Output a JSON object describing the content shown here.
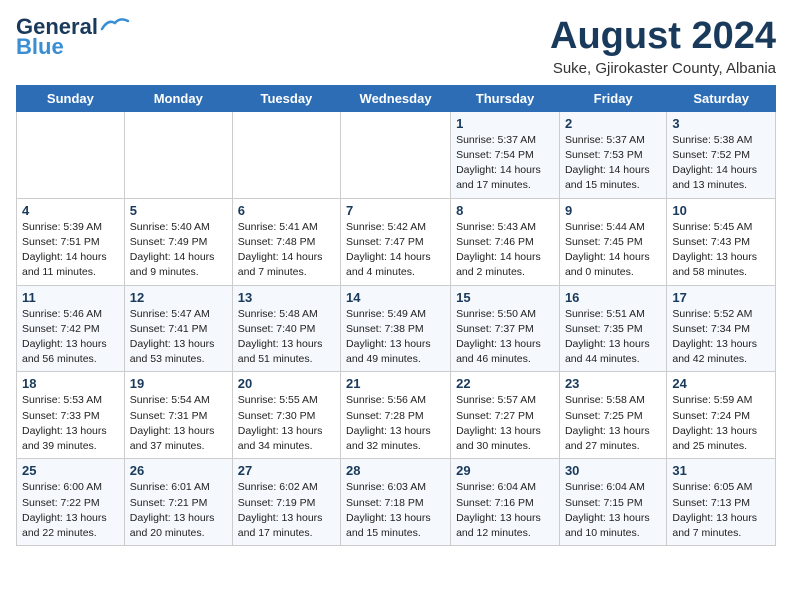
{
  "header": {
    "logo_line1": "General",
    "logo_line2": "Blue",
    "month": "August 2024",
    "location": "Suke, Gjirokaster County, Albania"
  },
  "weekdays": [
    "Sunday",
    "Monday",
    "Tuesday",
    "Wednesday",
    "Thursday",
    "Friday",
    "Saturday"
  ],
  "weeks": [
    [
      {
        "day": "",
        "info": ""
      },
      {
        "day": "",
        "info": ""
      },
      {
        "day": "",
        "info": ""
      },
      {
        "day": "",
        "info": ""
      },
      {
        "day": "1",
        "info": "Sunrise: 5:37 AM\nSunset: 7:54 PM\nDaylight: 14 hours\nand 17 minutes."
      },
      {
        "day": "2",
        "info": "Sunrise: 5:37 AM\nSunset: 7:53 PM\nDaylight: 14 hours\nand 15 minutes."
      },
      {
        "day": "3",
        "info": "Sunrise: 5:38 AM\nSunset: 7:52 PM\nDaylight: 14 hours\nand 13 minutes."
      }
    ],
    [
      {
        "day": "4",
        "info": "Sunrise: 5:39 AM\nSunset: 7:51 PM\nDaylight: 14 hours\nand 11 minutes."
      },
      {
        "day": "5",
        "info": "Sunrise: 5:40 AM\nSunset: 7:49 PM\nDaylight: 14 hours\nand 9 minutes."
      },
      {
        "day": "6",
        "info": "Sunrise: 5:41 AM\nSunset: 7:48 PM\nDaylight: 14 hours\nand 7 minutes."
      },
      {
        "day": "7",
        "info": "Sunrise: 5:42 AM\nSunset: 7:47 PM\nDaylight: 14 hours\nand 4 minutes."
      },
      {
        "day": "8",
        "info": "Sunrise: 5:43 AM\nSunset: 7:46 PM\nDaylight: 14 hours\nand 2 minutes."
      },
      {
        "day": "9",
        "info": "Sunrise: 5:44 AM\nSunset: 7:45 PM\nDaylight: 14 hours\nand 0 minutes."
      },
      {
        "day": "10",
        "info": "Sunrise: 5:45 AM\nSunset: 7:43 PM\nDaylight: 13 hours\nand 58 minutes."
      }
    ],
    [
      {
        "day": "11",
        "info": "Sunrise: 5:46 AM\nSunset: 7:42 PM\nDaylight: 13 hours\nand 56 minutes."
      },
      {
        "day": "12",
        "info": "Sunrise: 5:47 AM\nSunset: 7:41 PM\nDaylight: 13 hours\nand 53 minutes."
      },
      {
        "day": "13",
        "info": "Sunrise: 5:48 AM\nSunset: 7:40 PM\nDaylight: 13 hours\nand 51 minutes."
      },
      {
        "day": "14",
        "info": "Sunrise: 5:49 AM\nSunset: 7:38 PM\nDaylight: 13 hours\nand 49 minutes."
      },
      {
        "day": "15",
        "info": "Sunrise: 5:50 AM\nSunset: 7:37 PM\nDaylight: 13 hours\nand 46 minutes."
      },
      {
        "day": "16",
        "info": "Sunrise: 5:51 AM\nSunset: 7:35 PM\nDaylight: 13 hours\nand 44 minutes."
      },
      {
        "day": "17",
        "info": "Sunrise: 5:52 AM\nSunset: 7:34 PM\nDaylight: 13 hours\nand 42 minutes."
      }
    ],
    [
      {
        "day": "18",
        "info": "Sunrise: 5:53 AM\nSunset: 7:33 PM\nDaylight: 13 hours\nand 39 minutes."
      },
      {
        "day": "19",
        "info": "Sunrise: 5:54 AM\nSunset: 7:31 PM\nDaylight: 13 hours\nand 37 minutes."
      },
      {
        "day": "20",
        "info": "Sunrise: 5:55 AM\nSunset: 7:30 PM\nDaylight: 13 hours\nand 34 minutes."
      },
      {
        "day": "21",
        "info": "Sunrise: 5:56 AM\nSunset: 7:28 PM\nDaylight: 13 hours\nand 32 minutes."
      },
      {
        "day": "22",
        "info": "Sunrise: 5:57 AM\nSunset: 7:27 PM\nDaylight: 13 hours\nand 30 minutes."
      },
      {
        "day": "23",
        "info": "Sunrise: 5:58 AM\nSunset: 7:25 PM\nDaylight: 13 hours\nand 27 minutes."
      },
      {
        "day": "24",
        "info": "Sunrise: 5:59 AM\nSunset: 7:24 PM\nDaylight: 13 hours\nand 25 minutes."
      }
    ],
    [
      {
        "day": "25",
        "info": "Sunrise: 6:00 AM\nSunset: 7:22 PM\nDaylight: 13 hours\nand 22 minutes."
      },
      {
        "day": "26",
        "info": "Sunrise: 6:01 AM\nSunset: 7:21 PM\nDaylight: 13 hours\nand 20 minutes."
      },
      {
        "day": "27",
        "info": "Sunrise: 6:02 AM\nSunset: 7:19 PM\nDaylight: 13 hours\nand 17 minutes."
      },
      {
        "day": "28",
        "info": "Sunrise: 6:03 AM\nSunset: 7:18 PM\nDaylight: 13 hours\nand 15 minutes."
      },
      {
        "day": "29",
        "info": "Sunrise: 6:04 AM\nSunset: 7:16 PM\nDaylight: 13 hours\nand 12 minutes."
      },
      {
        "day": "30",
        "info": "Sunrise: 6:04 AM\nSunset: 7:15 PM\nDaylight: 13 hours\nand 10 minutes."
      },
      {
        "day": "31",
        "info": "Sunrise: 6:05 AM\nSunset: 7:13 PM\nDaylight: 13 hours\nand 7 minutes."
      }
    ]
  ]
}
